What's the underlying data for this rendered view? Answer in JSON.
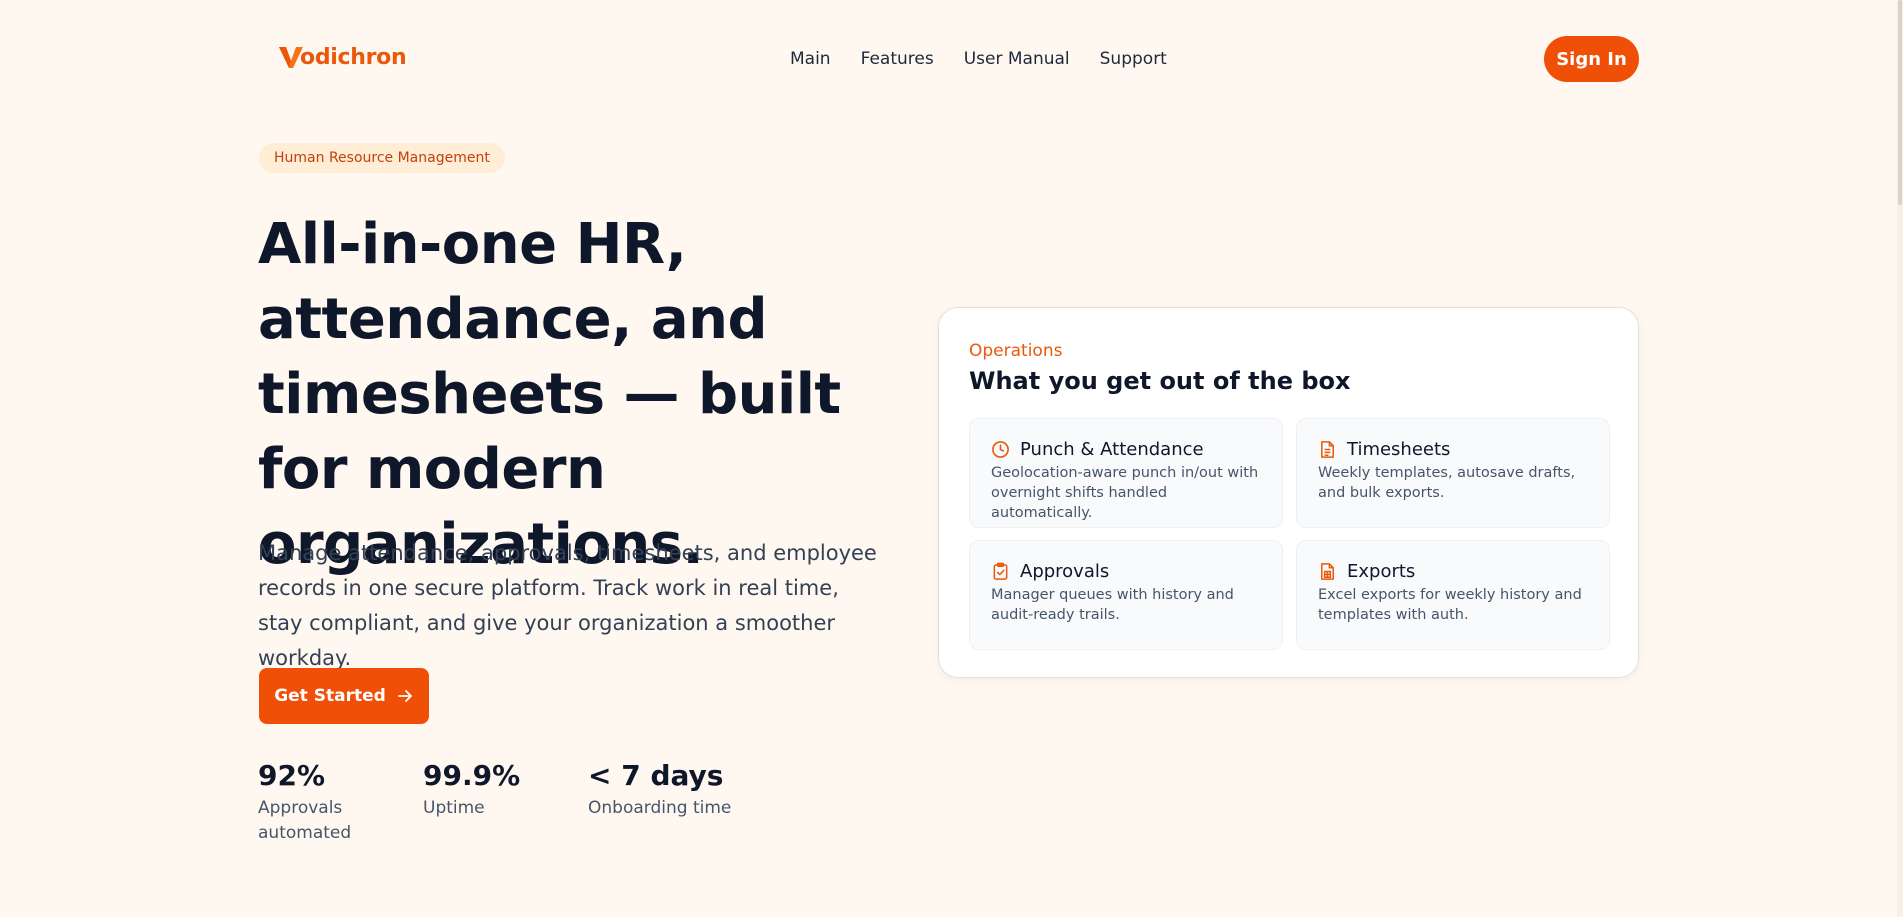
{
  "brand": {
    "name": "Vodichron",
    "logo_rest": "odichron",
    "accent": "#f04f07"
  },
  "nav": {
    "items": [
      {
        "label": "Main"
      },
      {
        "label": "Features"
      },
      {
        "label": "User Manual"
      },
      {
        "label": "Support"
      }
    ],
    "signin_label": "Sign In"
  },
  "hero": {
    "badge": "Human Resource Management",
    "title": "All-in-one HR, attendance, and timesheets — built for modern organizations.",
    "subtitle": "Manage attendance, approvals, timesheets, and employee records in one secure platform. Track work in real time, stay compliant, and give your organization a smoother workday.",
    "cta_label": "Get Started",
    "cta_icon": "arrow-right-icon"
  },
  "stats": [
    {
      "value": "92%",
      "label": "Approvals automated"
    },
    {
      "value": "99.9%",
      "label": "Uptime"
    },
    {
      "value": "< 7 days",
      "label": "Onboarding time"
    }
  ],
  "card": {
    "eyebrow": "Operations",
    "title": "What you get out of the box",
    "features": [
      {
        "title": "Punch & Attendance",
        "desc": "Geolocation-aware punch in/out with overnight shifts handled automatically.",
        "icon": "clock-icon"
      },
      {
        "title": "Timesheets",
        "desc": "Weekly templates, autosave drafts, and bulk exports.",
        "icon": "document-icon"
      },
      {
        "title": "Approvals",
        "desc": "Manager queues with history and audit-ready trails.",
        "icon": "clipboard-check-icon"
      },
      {
        "title": "Exports",
        "desc": "Excel exports for weekly history and templates with auth.",
        "icon": "spreadsheet-icon"
      }
    ]
  }
}
